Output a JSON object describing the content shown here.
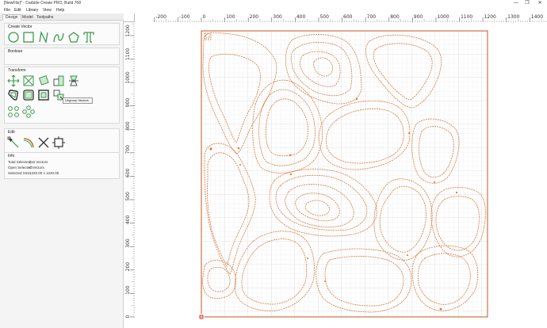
{
  "window": {
    "title": "[NewFile]* - Carbide Create PRO, Build 768",
    "controls": [
      "—",
      "❐",
      "✕"
    ]
  },
  "menu": [
    "File",
    "Edit",
    "Library",
    "View",
    "Help"
  ],
  "tabs": [
    "Design",
    "Model",
    "Toolpaths"
  ],
  "panels": {
    "create_vector": {
      "title": "Create Vector",
      "tools": [
        "circle-icon",
        "rectangle-icon",
        "polyline-icon",
        "curve-icon",
        "polygon-icon",
        "text-icon"
      ]
    },
    "boolean": {
      "title": "Boolean"
    },
    "transform": {
      "title": "Transform",
      "tools": [
        "move-icon",
        "scale-icon",
        "rotate-icon",
        "align-icon",
        "mirror-icon",
        "offset-icon",
        "group-icon",
        "ungroup-icon",
        "distribute-icon",
        "array-icon",
        "circular-array-icon"
      ],
      "tooltip": "Ungroup Vectors"
    },
    "edit": {
      "title": "Edit",
      "tools": [
        "node-edit-icon",
        "fillet-icon",
        "trim-icon",
        "join-icon"
      ]
    },
    "info": {
      "title": "Info",
      "total_selected_label": "Total Selected:",
      "total_selected_value": "116 Vectors",
      "open_selected_label": "Open Selected:",
      "open_selected_value": "0 Vectors",
      "selected_size_label": "Selected Size:",
      "selected_size_value": "1220.00 x 1220.00"
    }
  },
  "rulers": {
    "top_labels": [
      "-200",
      "-100",
      "0",
      "100",
      "200",
      "300",
      "400",
      "500",
      "600",
      "700",
      "800",
      "900",
      "1000",
      "1100",
      "1200",
      "1300",
      "1400"
    ],
    "left_labels": [
      "1200",
      "1100",
      "1000",
      "900",
      "800",
      "700",
      "600",
      "500",
      "400",
      "300",
      "200",
      "100",
      "0"
    ]
  },
  "colors": {
    "sidebar_bg": "#f4f4f4",
    "icon_green": "#3a9a4a",
    "vector_orange": "#d8763b",
    "stock_border": "#c15a22",
    "grid_minor": "#e3e3e3",
    "grid_major": "#c8c8c8"
  }
}
